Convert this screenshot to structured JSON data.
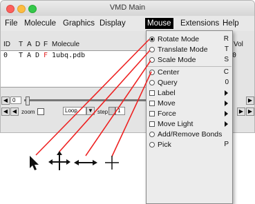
{
  "window": {
    "title": "VMD Main"
  },
  "menubar": {
    "items": [
      {
        "label": "File",
        "active": false
      },
      {
        "label": "Molecule",
        "active": false
      },
      {
        "label": "Graphics",
        "active": false
      },
      {
        "label": "Display",
        "active": false
      },
      {
        "label": "Mouse",
        "active": true
      },
      {
        "label": "Extensions",
        "active": false
      },
      {
        "label": "Help",
        "active": false
      }
    ]
  },
  "molecule_list": {
    "headers": [
      "ID",
      "T",
      "A",
      "D",
      "F",
      "Molecule"
    ],
    "right_header": "Vol",
    "row": {
      "id": "0",
      "t": "T",
      "a": "A",
      "d": "D",
      "f": "F",
      "molecule": "1ubq.pdb",
      "vol": "0"
    }
  },
  "controls": {
    "frame_value": "0",
    "zoom_label": "zoom",
    "loop_value": "Loop",
    "step_label": "step",
    "step_value": "1"
  },
  "mouse_menu": {
    "items": [
      {
        "label": "Rotate Mode",
        "shortcut": "R",
        "type": "radio",
        "selected": true
      },
      {
        "label": "Translate Mode",
        "shortcut": "T",
        "type": "radio",
        "selected": false
      },
      {
        "label": "Scale Mode",
        "shortcut": "S",
        "type": "radio",
        "selected": false
      },
      {
        "label": "Center",
        "shortcut": "C",
        "type": "radio",
        "selected": false
      },
      {
        "label": "Query",
        "shortcut": "0",
        "type": "radio",
        "selected": false
      },
      {
        "label": "Label",
        "submenu": true,
        "type": "check"
      },
      {
        "label": "Move",
        "submenu": true,
        "type": "check"
      },
      {
        "label": "Force",
        "submenu": true,
        "type": "check"
      },
      {
        "label": "Move Light",
        "submenu": true,
        "type": "check"
      },
      {
        "label": "Add/Remove Bonds",
        "type": "radio",
        "selected": false
      },
      {
        "label": "Pick",
        "shortcut": "P",
        "type": "radio",
        "selected": false
      }
    ]
  },
  "cursor_legend": {
    "icons": [
      "arrow-cursor-icon",
      "rotate-cursor-icon",
      "translate-cursor-icon",
      "scale-cursor-icon"
    ]
  },
  "colors": {
    "menu_active_bg": "#000000",
    "callout_line": "#ee2222"
  }
}
